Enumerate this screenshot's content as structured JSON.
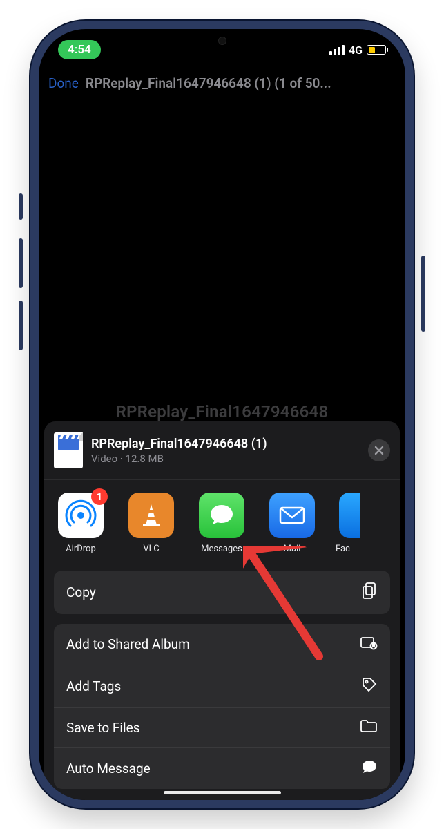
{
  "status": {
    "time": "4:54",
    "network": "4G"
  },
  "nav": {
    "done": "Done",
    "title": "RPReplay_Final1647946648 (1) (1 of 50..."
  },
  "background_label": "RPReplay_Final1647946648",
  "sheet": {
    "filename": "RPReplay_Final1647946648 (1)",
    "subtitle": "Video · 12.8 MB",
    "apps": [
      {
        "id": "airdrop",
        "label": "AirDrop",
        "badge": "1"
      },
      {
        "id": "vlc",
        "label": "VLC"
      },
      {
        "id": "messages",
        "label": "Messages"
      },
      {
        "id": "mail",
        "label": "Mail"
      },
      {
        "id": "extra",
        "label": "Fac"
      }
    ],
    "actions": {
      "copy": "Copy",
      "add_shared": "Add to Shared Album",
      "add_tags": "Add Tags",
      "save_files": "Save to Files",
      "auto_message": "Auto Message"
    }
  }
}
